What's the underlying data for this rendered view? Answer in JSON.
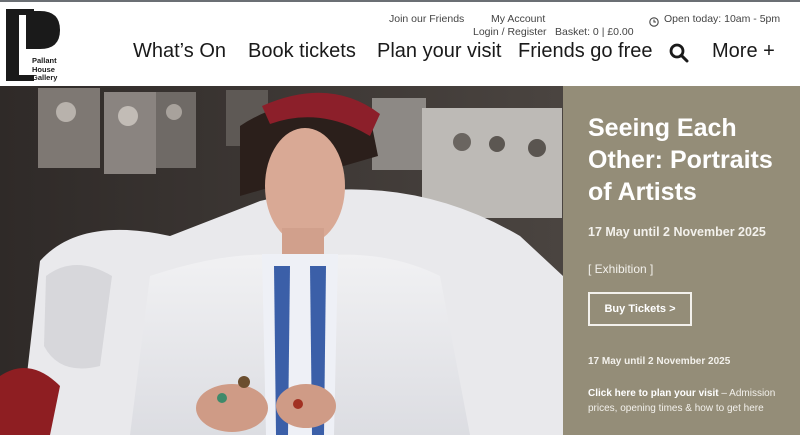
{
  "header": {
    "logo_lines": [
      "Pallant",
      "House",
      "Gallery"
    ],
    "utility": {
      "join_friends": "Join our Friends",
      "my_account": "My Account",
      "login_register": "Login / Register",
      "basket": "Basket: 0 | £0.00",
      "opening": "Open today: 10am - 5pm"
    },
    "nav": {
      "whats_on": "What’s On",
      "book_tickets": "Book tickets",
      "plan_visit": "Plan your visit",
      "friends_free": "Friends go free",
      "more": "More +"
    },
    "icons": {
      "search": "search-icon",
      "clock": "clock-icon"
    }
  },
  "hero": {
    "image_semantic": "portrait-photo",
    "panel_color": "#948d78",
    "title": "Seeing Each Other: Portraits of Artists",
    "dates": "17 May until 2 November 2025",
    "tag": "[ Exhibition ]",
    "buy_label": "Buy Tickets >",
    "dates_small": "17 May until 2 November 2025",
    "plan_link": "Click here to plan your visit",
    "plan_dash": " – ",
    "plan_desc": "Admission prices, opening times & how to get here"
  }
}
